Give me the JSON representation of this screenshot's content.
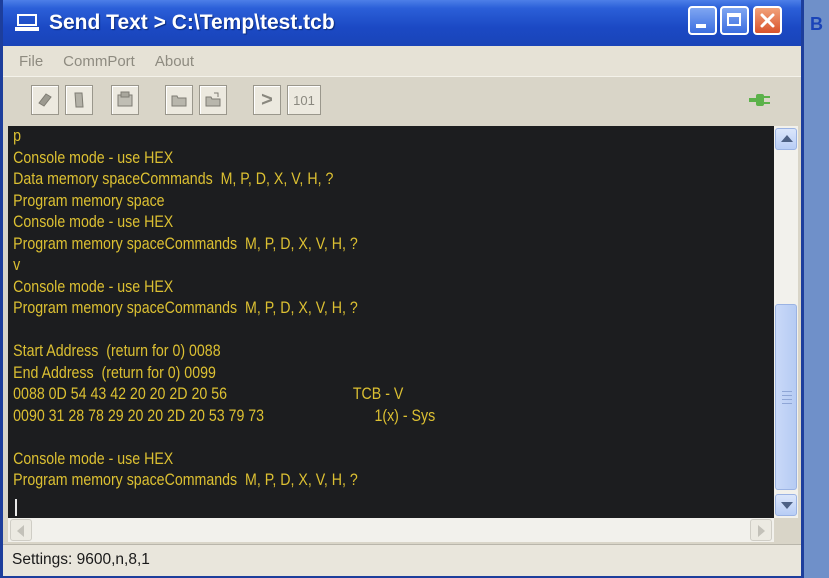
{
  "window": {
    "title": "Send Text > C:\\Temp\\test.tcb"
  },
  "side_letter": "B",
  "menu": [
    "File",
    "CommPort",
    "About"
  ],
  "toolbar": {
    "icons": [
      "send-file-icon",
      "clear-icon",
      "properties-icon",
      "open-folder-icon",
      "save-folder-icon",
      "prompt-icon",
      "binary-icon"
    ],
    "binary_label": "101",
    "prompt_label": ">",
    "status_icon": "plug-icon"
  },
  "console": {
    "lines": [
      "p",
      "Console mode - use HEX",
      "Data memory spaceCommands  M, P, D, X, V, H, ?",
      "Program memory space",
      "Console mode - use HEX",
      "Program memory spaceCommands  M, P, D, X, V, H, ?",
      "v",
      "Console mode - use HEX",
      "Program memory spaceCommands  M, P, D, X, V, H, ?",
      "",
      "Start Address  (return for 0) 0088",
      "End Address  (return for 0) 0099",
      "0088 0D 54 43 42 20 20 2D 20 56                                TCB - V",
      "0090 31 28 78 29 20 20 2D 20 53 79 73                            1(x) - Sys",
      "",
      "Console mode - use HEX",
      "Program memory spaceCommands  M, P, D, X, V, H, ?"
    ]
  },
  "statusbar": {
    "text": "Settings: 9600,n,8,1"
  },
  "colors": {
    "title_bar": "#1b49c4",
    "console_bg": "#1c1d1f",
    "console_text": "#dcc032",
    "close_button": "#d8532d"
  }
}
